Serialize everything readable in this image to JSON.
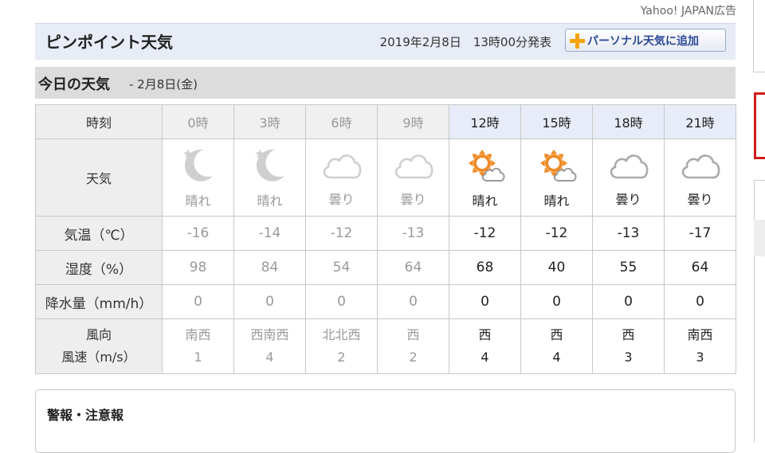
{
  "ad_label": "Yahoo! JAPAN広告",
  "header": {
    "title": "ピンポイント天気",
    "announced": "2019年2月8日　13時00分発表",
    "add_button_label": "パーソナル天気に追加"
  },
  "today": {
    "title": "今日の天気",
    "date": "- 2月8日(金)"
  },
  "table": {
    "row_labels": {
      "time": "時刻",
      "weather": "天気",
      "temp": "気温（℃）",
      "humidity": "湿度（%）",
      "rain": "降水量（mm/h）",
      "wind_dir": "風向",
      "wind_speed": "風速（m/s）"
    },
    "columns": [
      {
        "time": "0時",
        "icon": "moon-icon",
        "weather": "晴れ",
        "temp": "-16",
        "humidity": "98",
        "rain": "0",
        "wind_dir": "南西",
        "wind_speed": "1"
      },
      {
        "time": "3時",
        "icon": "moon-icon",
        "weather": "晴れ",
        "temp": "-14",
        "humidity": "84",
        "rain": "0",
        "wind_dir": "西南西",
        "wind_speed": "4"
      },
      {
        "time": "6時",
        "icon": "cloud-icon",
        "weather": "曇り",
        "temp": "-12",
        "humidity": "54",
        "rain": "0",
        "wind_dir": "北北西",
        "wind_speed": "2"
      },
      {
        "time": "9時",
        "icon": "cloud-icon",
        "weather": "曇り",
        "temp": "-13",
        "humidity": "64",
        "rain": "0",
        "wind_dir": "西",
        "wind_speed": "2"
      },
      {
        "time": "12時",
        "icon": "sun-cloud-icon",
        "weather": "晴れ",
        "temp": "-12",
        "humidity": "68",
        "rain": "0",
        "wind_dir": "西",
        "wind_speed": "4"
      },
      {
        "time": "15時",
        "icon": "sun-cloud-icon",
        "weather": "晴れ",
        "temp": "-12",
        "humidity": "40",
        "rain": "0",
        "wind_dir": "西",
        "wind_speed": "4"
      },
      {
        "time": "18時",
        "icon": "cloud-icon",
        "weather": "曇り",
        "temp": "-13",
        "humidity": "55",
        "rain": "0",
        "wind_dir": "西",
        "wind_speed": "3"
      },
      {
        "time": "21時",
        "icon": "cloud-icon",
        "weather": "曇り",
        "temp": "-17",
        "humidity": "64",
        "rain": "0",
        "wind_dir": "南西",
        "wind_speed": "3"
      }
    ]
  },
  "alerts": {
    "title": "警報・注意報"
  },
  "colors": {
    "header_bg": "#e7ecf6",
    "future_header_bg": "#e7ecf8",
    "sun_orange": "#f08a24",
    "sidebar_alert_red": "#d21a1a"
  }
}
